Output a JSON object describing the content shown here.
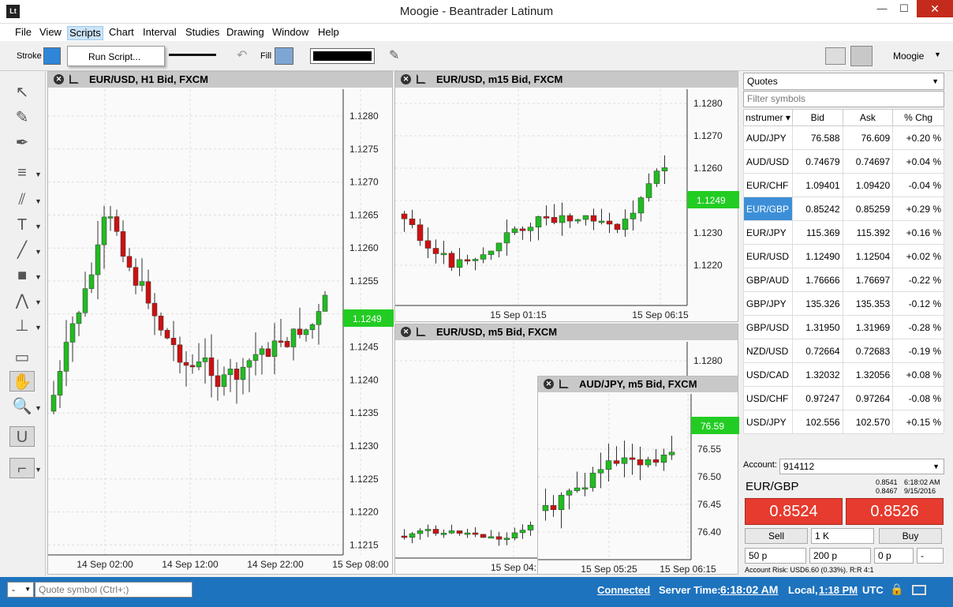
{
  "window": {
    "title": "Moogie - Beantrader Latinum",
    "logo": "Lt",
    "minimize": "—",
    "maximize": "☐",
    "close": "✕"
  },
  "menu": [
    "File",
    "View",
    "Scripts",
    "Chart",
    "Interval",
    "Studies",
    "Drawing",
    "Window",
    "Help"
  ],
  "toolbar": {
    "stroke_label": "Stroke",
    "fill_label": "Fill",
    "user": "Moogie"
  },
  "scripts_menu": {
    "run_script": "Run Script..."
  },
  "charts": {
    "h1": {
      "title": "EUR/USD, H1 Bid, FXCM",
      "price": "1.1249",
      "yticks": [
        "1.1280",
        "1.1275",
        "1.1270",
        "1.1265",
        "1.1260",
        "1.1255",
        "1.1250",
        "1.1245",
        "1.1240",
        "1.1235",
        "1.1230",
        "1.1225",
        "1.1220",
        "1.1215"
      ],
      "xticks": [
        "14 Sep 02:00",
        "14 Sep 12:00",
        "14 Sep 22:00",
        "15 Sep 08:00"
      ]
    },
    "m15": {
      "title": "EUR/USD, m15 Bid, FXCM",
      "price": "1.1249",
      "yticks": [
        "1.1280",
        "1.1270",
        "1.1260",
        "1.1240",
        "1.1230",
        "1.1220"
      ],
      "xticks": [
        "15 Sep 01:15",
        "15 Sep 06:15"
      ]
    },
    "m5": {
      "title": "EUR/USD, m5 Bid, FXCM",
      "yticks": [
        "1.1280"
      ],
      "xticks": [
        "15 Sep 04:"
      ]
    },
    "aud": {
      "title": "AUD/JPY, m5 Bid, FXCM",
      "price": "76.59",
      "yticks": [
        "76.55",
        "76.50",
        "76.45",
        "76.40"
      ],
      "xticks": [
        "15 Sep 05:25",
        "15 Sep 06:15"
      ]
    }
  },
  "quotes": {
    "selector": "Quotes",
    "filter_placeholder": "Filter symbols",
    "headers": [
      "nstrumer",
      "Bid",
      "Ask",
      "% Chg"
    ],
    "rows": [
      [
        "AUD/JPY",
        "76.588",
        "76.609",
        "+0.20 %"
      ],
      [
        "AUD/USD",
        "0.74679",
        "0.74697",
        "+0.04 %"
      ],
      [
        "EUR/CHF",
        "1.09401",
        "1.09420",
        "-0.04 %"
      ],
      [
        "EUR/GBP",
        "0.85242",
        "0.85259",
        "+0.29 %"
      ],
      [
        "EUR/JPY",
        "115.369",
        "115.392",
        "+0.16 %"
      ],
      [
        "EUR/USD",
        "1.12490",
        "1.12504",
        "+0.02 %"
      ],
      [
        "GBP/AUD",
        "1.76666",
        "1.76697",
        "-0.22 %"
      ],
      [
        "GBP/JPY",
        "135.326",
        "135.353",
        "-0.12 %"
      ],
      [
        "GBP/USD",
        "1.31950",
        "1.31969",
        "-0.28 %"
      ],
      [
        "NZD/USD",
        "0.72664",
        "0.72683",
        "-0.19 %"
      ],
      [
        "USD/CAD",
        "1.32032",
        "1.32056",
        "+0.08 %"
      ],
      [
        "USD/CHF",
        "0.97247",
        "0.97264",
        "-0.08 %"
      ],
      [
        "USD/JPY",
        "102.556",
        "102.570",
        "+0.15 %"
      ]
    ]
  },
  "trade": {
    "account_label": "Account:",
    "account": "914112",
    "symbol": "EUR/GBP",
    "hi": "0.8541",
    "lo": "0.8467",
    "time": "6:18:02 AM",
    "date": "9/15/2016",
    "sell_price": "0.8524",
    "buy_price": "0.8526",
    "sell": "Sell",
    "buy": "Buy",
    "qty": "1 K",
    "sl": "50 p",
    "tp": "200 p",
    "trail": "0 p",
    "dash": "-",
    "risk": "Account Risk: USD6.60 (0.33%). R:R 4:1"
  },
  "status": {
    "prefix": "-",
    "quote_placeholder": "Quote symbol (Ctrl+;)",
    "connected": "Connected",
    "server_label": "Server Time:",
    "server_time": "6:18:02 AM",
    "local_label": "Local,",
    "local_time": "1:18 PM",
    "tz": "UTC"
  },
  "colors": {
    "up": "#22bb22",
    "down": "#cc1111",
    "price_tag": "#22cc22",
    "accent": "#1e73be",
    "sell_buy": "#e63b2e"
  }
}
